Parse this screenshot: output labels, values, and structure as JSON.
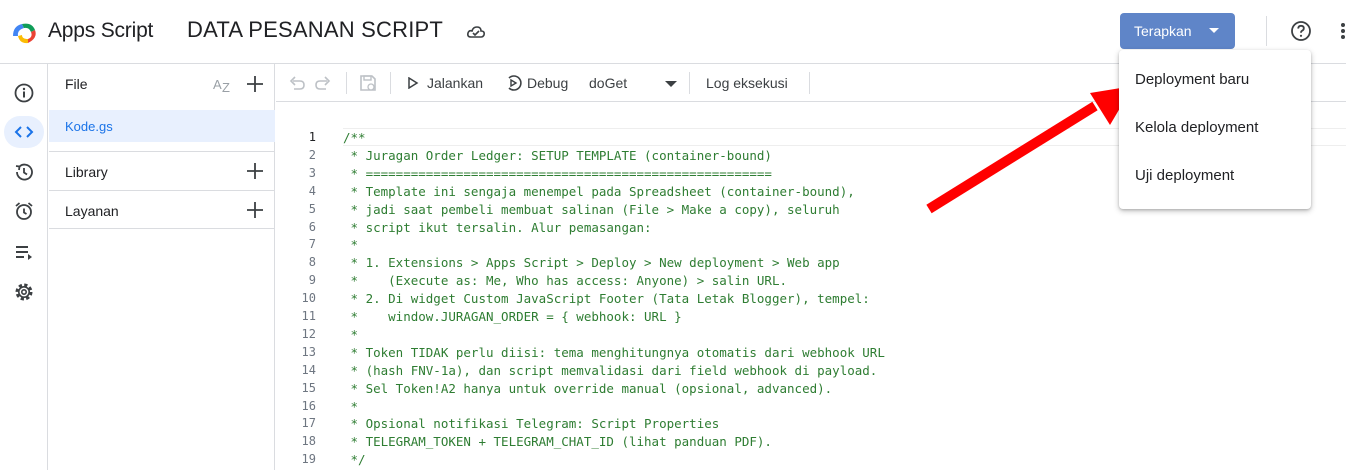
{
  "header": {
    "app_name": "Apps Script",
    "project_title": "DATA PESANAN SCRIPT",
    "deploy_label": "Terapkan"
  },
  "rail": {
    "items": [
      "info-icon",
      "code-icon",
      "history-icon",
      "alarm-icon",
      "executions-icon",
      "settings-icon"
    ],
    "active": "code-icon"
  },
  "files": {
    "title": "File",
    "items": [
      "Kode.gs"
    ],
    "sections": [
      "Library",
      "Layanan"
    ]
  },
  "toolbar": {
    "run_label": "Jalankan",
    "debug_label": "Debug",
    "function_name": "doGet",
    "log_label": "Log eksekusi"
  },
  "code": {
    "line_numbers": [
      "1",
      "2",
      "3",
      "4",
      "5",
      "6",
      "7",
      "8",
      "9",
      "10",
      "11",
      "12",
      "13",
      "14",
      "15",
      "16",
      "17",
      "18",
      "19"
    ],
    "lines": [
      "/**",
      " * Juragan Order Ledger: SETUP TEMPLATE (container-bound)",
      " * ======================================================",
      " * Template ini sengaja menempel pada Spreadsheet (container-bound),",
      " * jadi saat pembeli membuat salinan (File > Make a copy), seluruh",
      " * script ikut tersalin. Alur pemasangan:",
      " *",
      " * 1. Extensions > Apps Script > Deploy > New deployment > Web app",
      " *    (Execute as: Me, Who has access: Anyone) > salin URL.",
      " * 2. Di widget Custom JavaScript Footer (Tata Letak Blogger), tempel:",
      " *    window.JURAGAN_ORDER = { webhook: URL }",
      " *",
      " * Token TIDAK perlu diisi: tema menghitungnya otomatis dari webhook URL",
      " * (hash FNV-1a), dan script memvalidasi dari field webhook di payload.",
      " * Sel Token!A2 hanya untuk override manual (opsional, advanced).",
      " *",
      " * Opsional notifikasi Telegram: Script Properties",
      " * TELEGRAM_TOKEN + TELEGRAM_CHAT_ID (lihat panduan PDF).",
      " */"
    ]
  },
  "deploy_menu": {
    "items": [
      "Deployment baru",
      "Kelola deployment",
      "Uji deployment"
    ]
  },
  "colors": {
    "deploy_button": "#5f85c8",
    "comment_text": "#2e7d32",
    "active_file_bg": "#e8f0fe",
    "annotation_arrow": "#ff0000"
  }
}
